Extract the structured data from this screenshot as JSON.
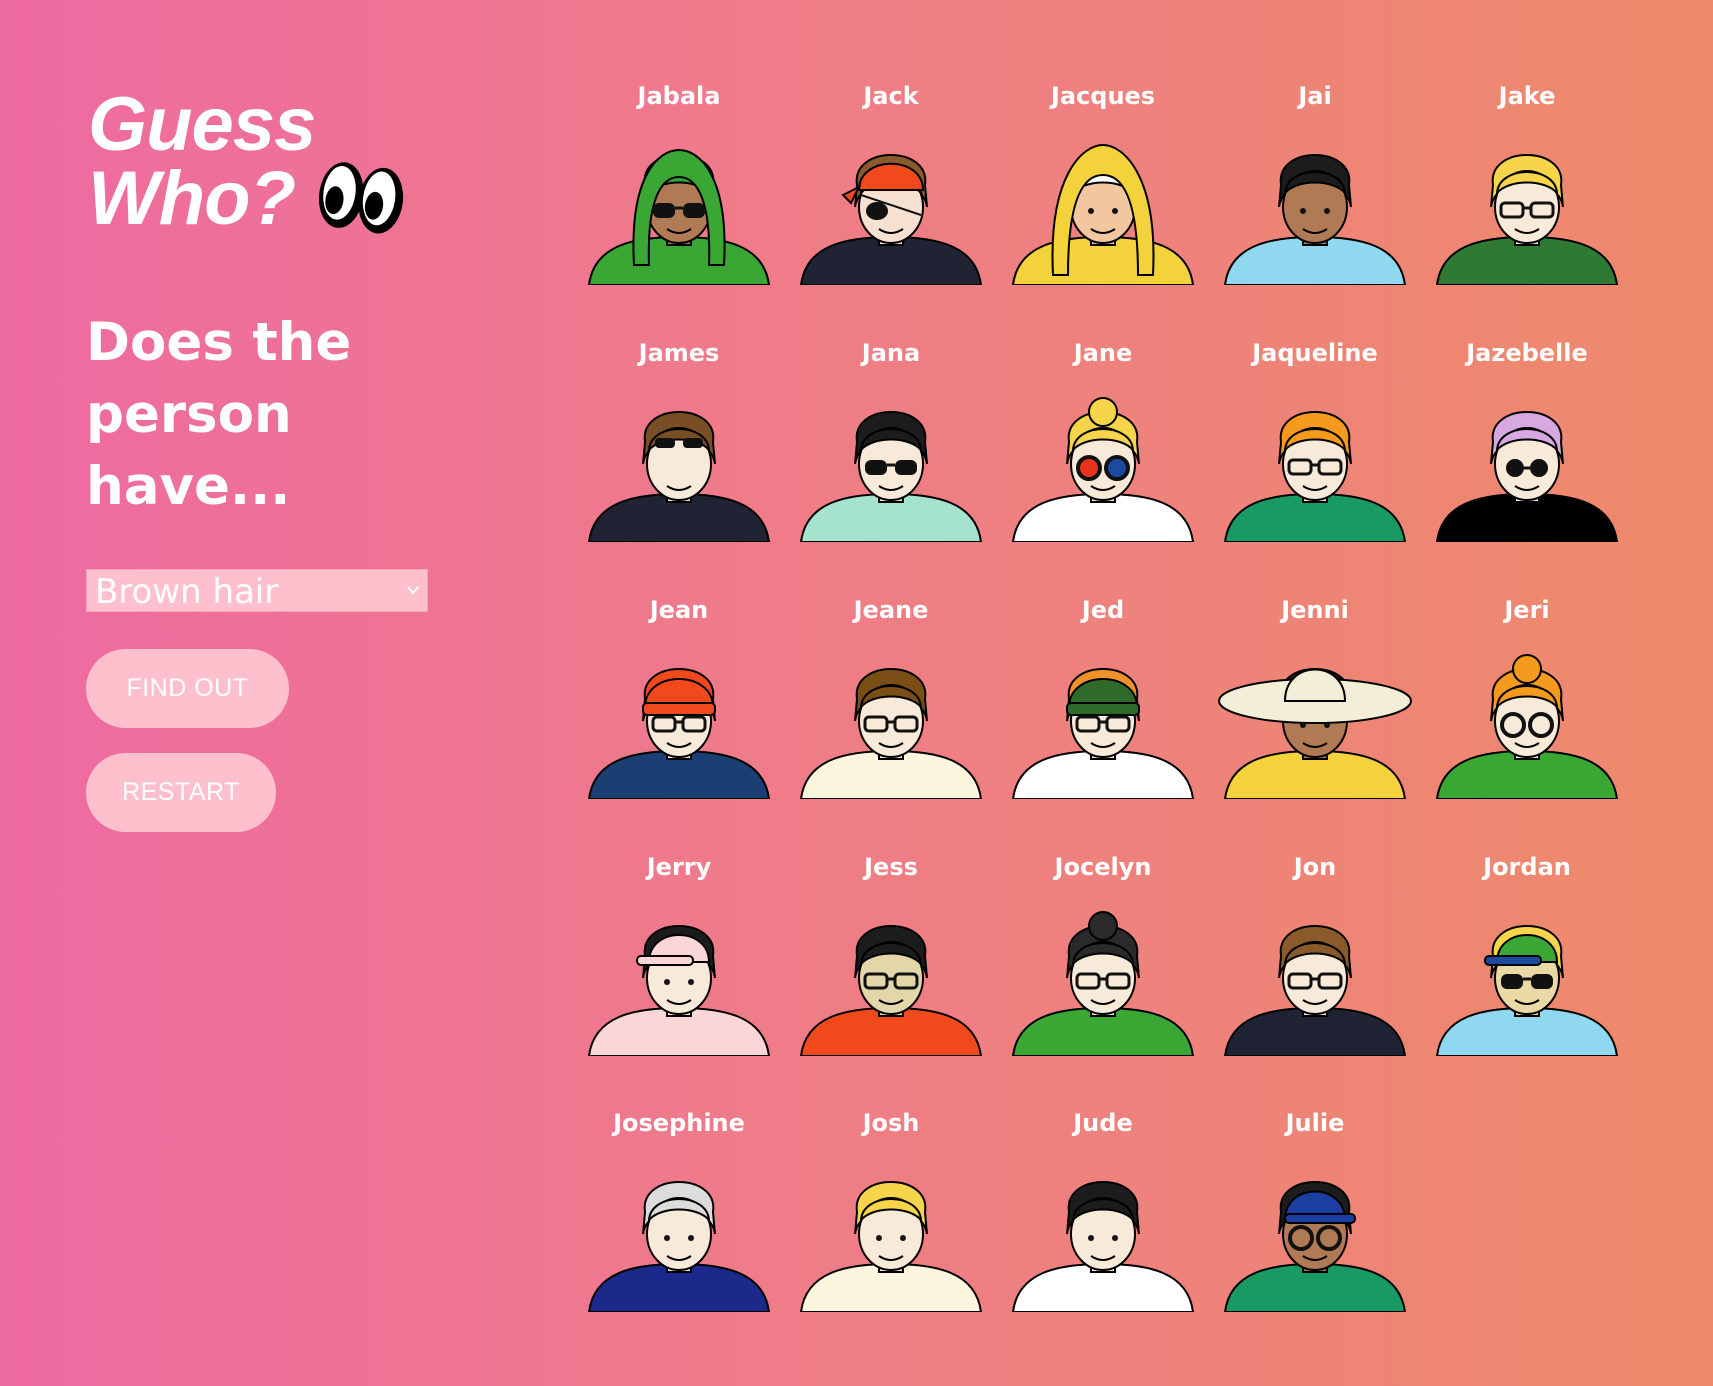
{
  "logo": {
    "line1": "Guess",
    "line2": "Who?"
  },
  "question": "Does the person have...",
  "select": {
    "value": "Brown hair"
  },
  "buttons": {
    "find_out": "FIND OUT",
    "restart": "RESTART"
  },
  "colors": {
    "button_bg": "#ffc0cd",
    "gradient_start": "#ee6aa2",
    "gradient_end": "#ee8a6a"
  },
  "characters": [
    {
      "name": "Jabala",
      "skin": "#b07a55",
      "hair": "#3aa633",
      "shirt": "#3aa633",
      "hat": "hood",
      "glasses": "sun"
    },
    {
      "name": "Jack",
      "skin": "#f6e0cf",
      "hair": "#8a5a2b",
      "shirt": "#1f2333",
      "hat": "bandana",
      "glasses": "patch"
    },
    {
      "name": "Jacques",
      "skin": "#f2c7a0",
      "hair": "#ffffff",
      "shirt": "#f4d23c",
      "hat": "hood-yellow",
      "glasses": "none"
    },
    {
      "name": "Jai",
      "skin": "#b07a55",
      "hair": "#1c1c1c",
      "shirt": "#8fd8f0",
      "hat": "none",
      "glasses": "none"
    },
    {
      "name": "Jake",
      "skin": "#f8ead9",
      "hair": "#f6d54a",
      "shirt": "#2f7a32",
      "hat": "none",
      "glasses": "clear"
    },
    {
      "name": "James",
      "skin": "#f8ead9",
      "hair": "#7a4e24",
      "shirt": "#1f2333",
      "hat": "none",
      "glasses": "sun-head"
    },
    {
      "name": "Jana",
      "skin": "#f8ead9",
      "hair": "#1c1c1c",
      "shirt": "#a6e3cf",
      "hat": "none",
      "glasses": "sun"
    },
    {
      "name": "Jane",
      "skin": "#f8ead9",
      "hair": "#f6d54a",
      "shirt": "#ffffff",
      "hat": "bun",
      "glasses": "color"
    },
    {
      "name": "Jaqueline",
      "skin": "#f8ead9",
      "hair": "#f59a1c",
      "shirt": "#189a62",
      "hat": "none",
      "glasses": "clear"
    },
    {
      "name": "Jazebelle",
      "skin": "#f8ead9",
      "hair": "#d8a8e0",
      "shirt": "#000000",
      "hat": "none",
      "glasses": "sun-round"
    },
    {
      "name": "Jean",
      "skin": "#f8ead9",
      "hair": "#f04a1c",
      "shirt": "#1b3f73",
      "hat": "beanie",
      "glasses": "clear"
    },
    {
      "name": "Jeane",
      "skin": "#f8ead9",
      "hair": "#7a4e14",
      "shirt": "#fcf6df",
      "hat": "none",
      "glasses": "clear"
    },
    {
      "name": "Jed",
      "skin": "#f8ead9",
      "hair": "#f0902a",
      "shirt": "#ffffff",
      "hat": "beanie-green",
      "glasses": "clear"
    },
    {
      "name": "Jenni",
      "skin": "#b07a55",
      "hair": "#1c1c1c",
      "shirt": "#f4d23c",
      "hat": "sunhat",
      "glasses": "none"
    },
    {
      "name": "Jeri",
      "skin": "#f8ead9",
      "hair": "#f59a1c",
      "shirt": "#3aa633",
      "hat": "bun",
      "glasses": "round"
    },
    {
      "name": "Jerry",
      "skin": "#f8ead9",
      "hair": "#1c1c1c",
      "shirt": "#fbd6d6",
      "hat": "cap-pink",
      "glasses": "none"
    },
    {
      "name": "Jess",
      "skin": "#e3d6a8",
      "hair": "#1c1c1c",
      "shirt": "#f04a1c",
      "hat": "none",
      "glasses": "clear"
    },
    {
      "name": "Jocelyn",
      "skin": "#f8ead9",
      "hair": "#2a2a2a",
      "shirt": "#3aa633",
      "hat": "bun-dark",
      "glasses": "clear"
    },
    {
      "name": "Jon",
      "skin": "#f8ead9",
      "hair": "#8a5a2b",
      "shirt": "#1f2333",
      "hat": "none",
      "glasses": "clear"
    },
    {
      "name": "Jordan",
      "skin": "#e8d9a5",
      "hair": "#f6d54a",
      "shirt": "#8fd8f0",
      "hat": "cap-green",
      "glasses": "sun"
    },
    {
      "name": "Josephine",
      "skin": "#f8ead9",
      "hair": "#dcdcdc",
      "shirt": "#1b2a8a",
      "hat": "none",
      "glasses": "none"
    },
    {
      "name": "Josh",
      "skin": "#f8ead9",
      "hair": "#f6d54a",
      "shirt": "#fcf6df",
      "hat": "none",
      "glasses": "none"
    },
    {
      "name": "Jude",
      "skin": "#f8ead9",
      "hair": "#1c1c1c",
      "shirt": "#ffffff",
      "hat": "none",
      "glasses": "none"
    },
    {
      "name": "Julie",
      "skin": "#b07a55",
      "hair": "#1c1c1c",
      "shirt": "#189a62",
      "hat": "cap-blue",
      "glasses": "round"
    }
  ]
}
